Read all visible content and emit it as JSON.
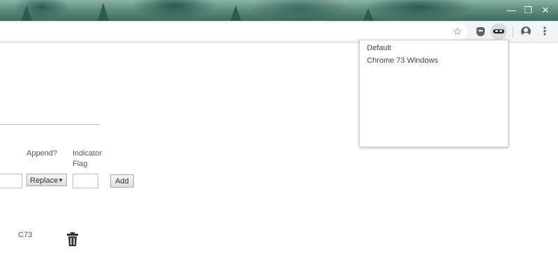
{
  "window": {
    "controls": {
      "minimize": "—",
      "restore": "❐",
      "close": "✕"
    }
  },
  "toolbar": {
    "icons": [
      "bookmark-star-icon",
      "privacy-shield-icon",
      "user-agent-switcher-icon",
      "account-icon",
      "more-menu-icon"
    ],
    "star_glyph": "☆",
    "menu_glyph": "⋮"
  },
  "popup": {
    "items": [
      "Default",
      "Chrome 73 Windows"
    ]
  },
  "form": {
    "append_label": "Append?",
    "indicator_label_line1": "Indicator",
    "indicator_label_line2": "Flag",
    "select_value": "Replace",
    "select_arrow": "▼",
    "add_label": "Add"
  },
  "entries": [
    {
      "indicator": "C73"
    }
  ],
  "colors": {
    "toolbar_bg": "#f1f3f4",
    "extension_active_bg": "#dadce0"
  }
}
